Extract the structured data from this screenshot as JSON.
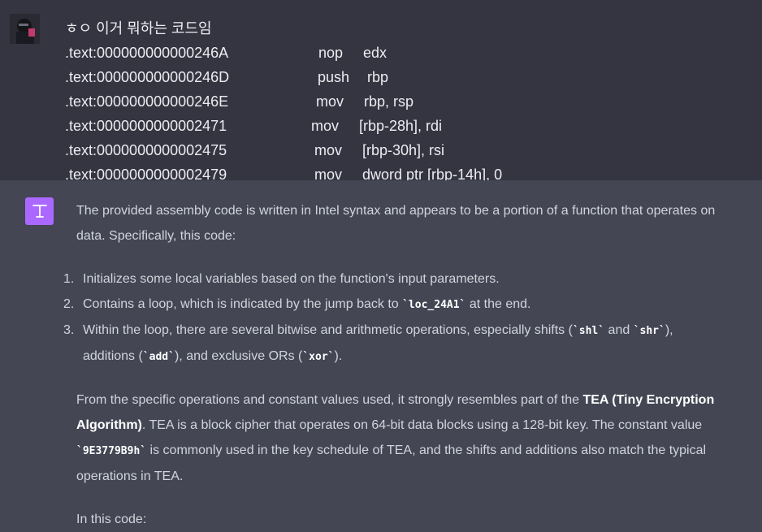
{
  "user": {
    "question": "ㅎㅇ 이거 뭐하는 코드임",
    "asm": [
      {
        "addr": ".text:000000000000246A",
        "op": "nop",
        "args": "edx"
      },
      {
        "addr": ".text:000000000000246D",
        "op": "push",
        "args": "rbp"
      },
      {
        "addr": ".text:000000000000246E",
        "op": "mov",
        "args": "rbp, rsp"
      },
      {
        "addr": ".text:0000000000002471",
        "op": "mov",
        "args": "[rbp-28h], rdi"
      },
      {
        "addr": ".text:0000000000002475",
        "op": "mov",
        "args": "[rbp-30h], rsi"
      },
      {
        "addr": ".text:0000000000002479",
        "op": "mov",
        "args": "dword ptr [rbp-14h], 0"
      }
    ]
  },
  "assistant": {
    "avatar_icon": "openai-logo-icon",
    "accent_color": "#ab68ff",
    "intro": "The provided assembly code is written in Intel syntax and appears to be a portion of a function that operates on data. Specifically, this code:",
    "list": [
      {
        "num": "1.",
        "text": "Initializes some local variables based on the function's input parameters."
      },
      {
        "num": "2.",
        "pre": "Contains a loop, which is indicated by the jump back to ",
        "code1": "`loc_24A1`",
        "post": " at the end."
      },
      {
        "num": "3.",
        "pre": "Within the loop, there are several bitwise and arithmetic operations, especially shifts (",
        "code1": "`shl`",
        "mid1": " and ",
        "code2": "`shr`",
        "mid2": "), additions (",
        "code3": "`add`",
        "mid3": "), and exclusive ORs (",
        "code4": "`xor`",
        "post": ")."
      }
    ],
    "para2": {
      "pre": "From the specific operations and constant values used, it strongly resembles part of the ",
      "bold": "TEA (Tiny Encryption Algorithm)",
      "mid": ". TEA is a block cipher that operates on 64-bit data blocks using a 128-bit key. The constant value ",
      "code": "`9E3779B9h`",
      "post": " is commonly used in the key schedule of TEA, and the shifts and additions also match the typical operations in TEA."
    },
    "para3": "In this code:"
  }
}
